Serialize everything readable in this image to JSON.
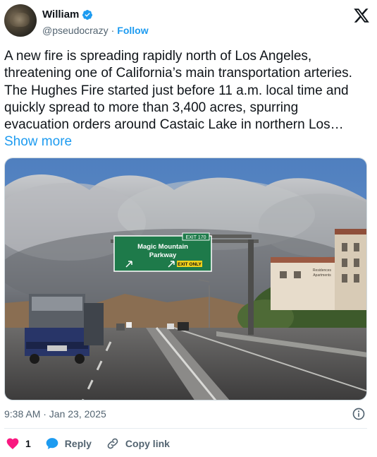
{
  "user": {
    "display_name": "William",
    "handle": "@pseudocrazy",
    "separator": "·",
    "follow_label": "Follow"
  },
  "tweet": {
    "text": "A new fire is spreading rapidly north of Los Angeles, threatening one of California’s main transportation arteries. The Hughes Fire started just before 11 a.m. local time and quickly spread to more than 3,400 acres, spurring evacuation orders around Castaic Lake in northern Los…",
    "show_more_label": "Show more",
    "timestamp": "9:38 AM · Jan 23, 2025"
  },
  "media": {
    "sign_exit": "EXIT 170",
    "sign_line1": "Magic Mountain",
    "sign_line2": "Parkway",
    "sign_exit_only": "EXIT ONLY",
    "building_sign_line1": "Residences",
    "building_sign_line2": "Apartments"
  },
  "actions": {
    "like_count": "1",
    "reply_label": "Reply",
    "copy_link_label": "Copy link"
  },
  "colors": {
    "accent": "#1d9bf0",
    "like": "#f91880",
    "text": "#0f1419",
    "secondary": "#536471",
    "sign_green": "#1e7a4a"
  },
  "icons": [
    "verified-badge-icon",
    "x-logo-icon",
    "info-icon",
    "heart-icon",
    "reply-icon",
    "link-icon"
  ]
}
